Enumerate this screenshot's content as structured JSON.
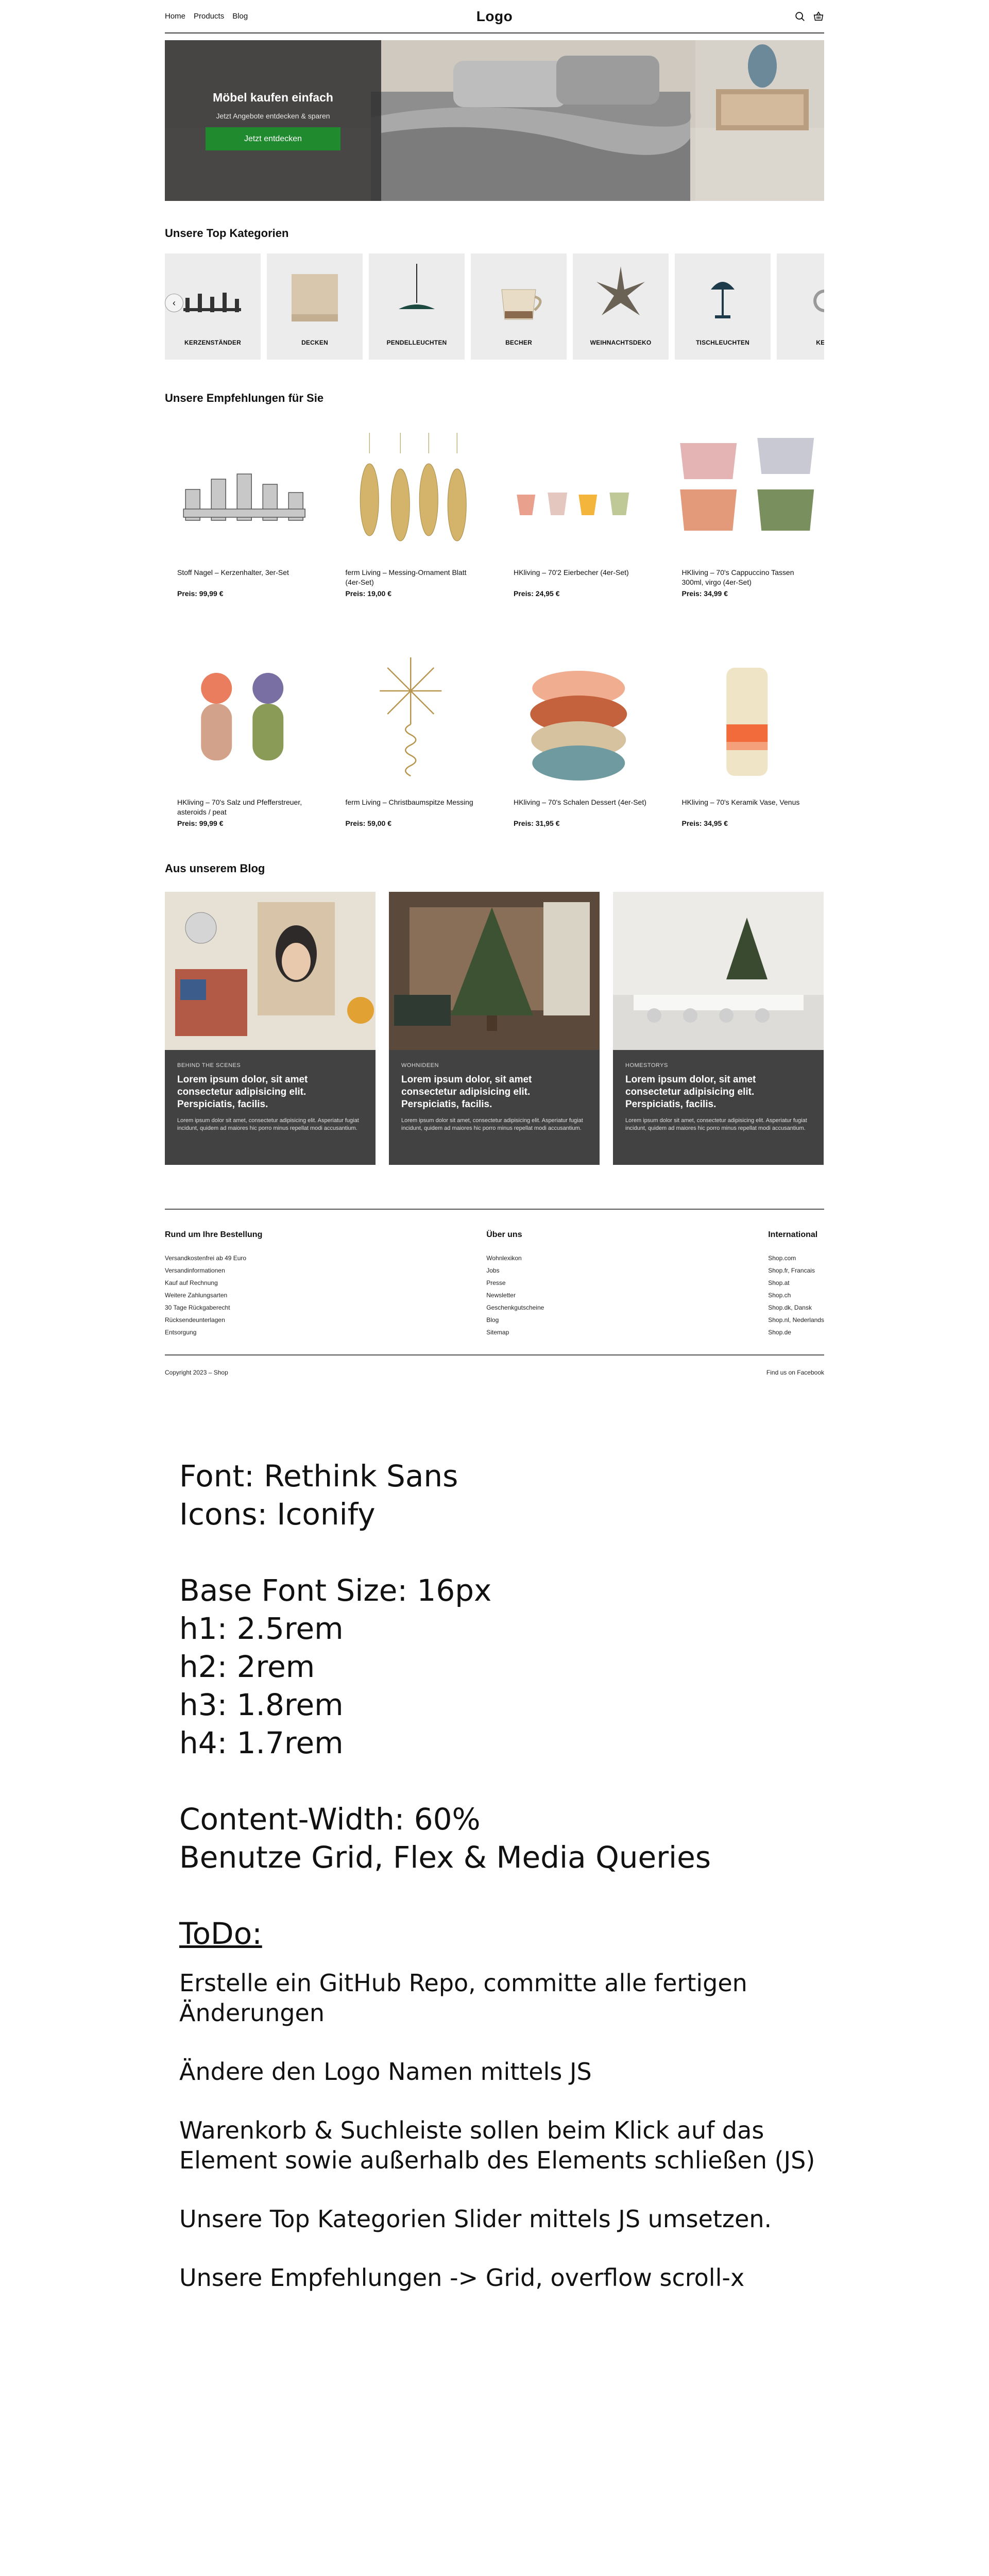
{
  "header": {
    "nav": [
      "Home",
      "Products",
      "Blog"
    ],
    "logo": "Logo",
    "icons": [
      "search-icon",
      "basket-icon"
    ]
  },
  "hero": {
    "title": "Möbel kaufen einfach",
    "subtitle": "Jetzt Angebote entdecken & sparen",
    "button": "Jetzt entdecken",
    "button_color": "#1f8a2e"
  },
  "categories": {
    "title": "Unsere Top Kategorien",
    "prev_icon": "chevron-left-icon",
    "items": [
      {
        "label": "KERZENSTÄNDER"
      },
      {
        "label": "DECKEN"
      },
      {
        "label": "PENDELLEUCHTEN"
      },
      {
        "label": "BECHER"
      },
      {
        "label": "WEIHNACHTSDEKO"
      },
      {
        "label": "TISCHLEUCHTEN"
      },
      {
        "label": "KERZ"
      }
    ]
  },
  "recommendations": {
    "title": "Unsere Empfehlungen für Sie",
    "products": [
      {
        "name": "Stoff Nagel – Kerzenhalter, 3er-Set",
        "price": "Preis: 99,99 €"
      },
      {
        "name": "ferm Living – Messing-Ornament Blatt (4er-Set)",
        "price": "Preis: 19,00 €"
      },
      {
        "name": "HKliving – 70'2 Eierbecher (4er-Set)",
        "price": "Preis: 24,95 €"
      },
      {
        "name": "HKliving – 70's Cappuccino Tassen 300ml, virgo (4er-Set)",
        "price": "Preis: 34,99 €"
      },
      {
        "name": "HKliving – 70's Salz und Pfefferstreuer, asteroids / peat",
        "price": "Preis: 99,99 €"
      },
      {
        "name": "ferm Living – Christbaumspitze Messing",
        "price": "Preis: 59,00 €"
      },
      {
        "name": "HKliving – 70's Schalen Dessert (4er-Set)",
        "price": "Preis: 31,95 €"
      },
      {
        "name": "HKliving – 70's Keramik Vase, Venus",
        "price": "Preis: 34,95 €"
      }
    ]
  },
  "blog": {
    "title": "Aus unserem Blog",
    "posts": [
      {
        "category": "BEHIND THE SCENES",
        "title": "Lorem ipsum dolor, sit amet consectetur adipisicing elit. Perspiciatis, facilis.",
        "text": "Lorem ipsum dolor sit amet, consectetur adipisicing elit. Asperiatur fugiat incidunt, quidem ad maiores hic porro minus repellat modi accusantium."
      },
      {
        "category": "WOHNIDEEN",
        "title": "Lorem ipsum dolor, sit amet consectetur adipisicing elit. Perspiciatis, facilis.",
        "text": "Lorem ipsum dolor sit amet, consectetur adipisicing elit. Asperiatur fugiat incidunt, quidem ad maiores hic porro minus repellat modi accusantium."
      },
      {
        "category": "HOMESTORYS",
        "title": "Lorem ipsum dolor, sit amet consectetur adipisicing elit. Perspiciatis, facilis.",
        "text": "Lorem ipsum dolor sit amet, consectetur adipisicing elit. Asperiatur fugiat incidunt, quidem ad maiores hic porro minus repellat modi accusantium."
      }
    ]
  },
  "footer": {
    "col1": {
      "title": "Rund um Ihre Bestellung",
      "links": [
        "Versandkostenfrei ab 49 Euro",
        "Versandinformationen",
        "Kauf auf Rechnung",
        "Weitere Zahlungsarten",
        "30 Tage Rückgaberecht",
        "Rücksendeunterlagen",
        "Entsorgung"
      ]
    },
    "col2": {
      "title": "Über uns",
      "links": [
        "Wohnlexikon",
        "Jobs",
        "Presse",
        "Newsletter",
        "Geschenkgutscheine",
        "Blog",
        "Sitemap"
      ]
    },
    "col3": {
      "title": "International",
      "links": [
        "Shop.com",
        "Shop.fr, Francais",
        "Shop.at",
        "Shop.ch",
        "Shop.dk, Dansk",
        "Shop.nl, Nederlands",
        "Shop.de"
      ]
    },
    "copyright": "Copyright 2023 – Shop",
    "social": "Find us on Facebook"
  },
  "notes": {
    "font": "Font: Rethink Sans",
    "icons": "Icons: Iconify",
    "base": "Base Font Size: 16px",
    "h1": "h1: 2.5rem",
    "h2": "h2: 2rem",
    "h3": "h3: 1.8rem",
    "h4": "h4: 1.7rem",
    "width": "Content-Width: 60%",
    "layout": "Benutze Grid, Flex & Media Queries",
    "todo": "ToDo:",
    "t1a": "Erstelle ein GitHub Repo, committe alle fertigen",
    "t1b": "Änderungen",
    "t2": "Ändere den Logo Namen mittels JS",
    "t3a": "Warenkorb & Suchleiste sollen beim Klick auf das",
    "t3b": "Element sowie außerhalb des Elements schließen (JS)",
    "t4": "Unsere Top Kategorien Slider mittels JS umsetzen.",
    "t5": "Unsere Empfehlungen -> Grid, overflow scroll-x"
  }
}
